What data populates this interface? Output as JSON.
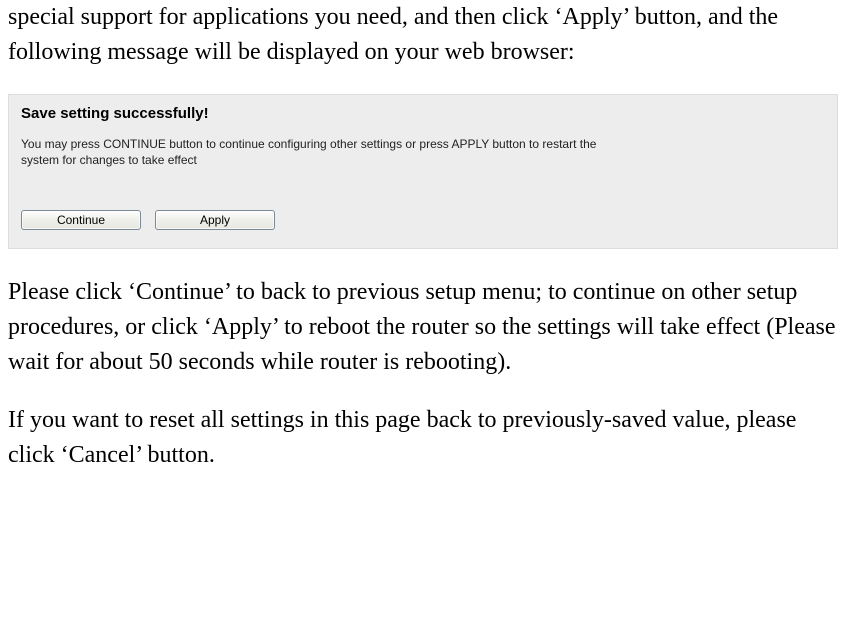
{
  "intro_text": "special support for applications you need, and then click ‘Apply’ button, and the following message will be displayed on your web browser:",
  "panel": {
    "heading": "Save setting successfully!",
    "description": "You may press CONTINUE button to continue configuring other settings or press APPLY button to restart the\nsystem for changes to take effect",
    "continue_label": "Continue",
    "apply_label": "Apply"
  },
  "after_text_1": "Please click ‘Continue’ to back to previous setup menu; to continue on other setup procedures, or click ‘Apply’ to reboot the router so the settings will take effect (Please wait for about 50 seconds while router is rebooting).",
  "after_text_2": "If you want to reset all settings in this page back to previously-saved value, please click ‘Cancel’ button."
}
